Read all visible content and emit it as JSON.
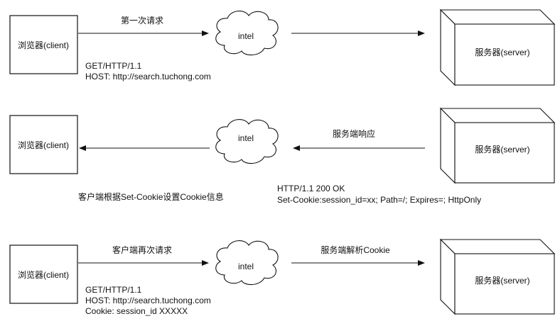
{
  "rows": [
    {
      "client_label": "浏览器(client)",
      "cloud_label": "intel",
      "server_label": "服务器(server)",
      "arrow_left_label": "第一次请求",
      "arrow_right_label": "",
      "note_lines": [
        "GET/HTTP/1.1",
        "HOST: http://search.tuchong.com"
      ]
    },
    {
      "client_label": "浏览器(client)",
      "cloud_label": "intel",
      "server_label": "服务器(server)",
      "arrow_right_label": "服务端响应",
      "note_left": "客户端根据Set-Cookie设置Cookie信息",
      "note_right_lines": [
        "HTTP/1.1 200 OK",
        "Set-Cookie:session_id=xx; Path=/; Expires=; HttpOnly"
      ]
    },
    {
      "client_label": "浏览器(client)",
      "cloud_label": "intel",
      "server_label": "服务器(server)",
      "arrow_left_label": "客户端再次请求",
      "arrow_right_label": "服务端解析Cookie",
      "note_lines": [
        "GET/HTTP/1.1",
        "HOST: http://search.tuchong.com",
        "Cookie: session_id XXXXX"
      ]
    }
  ]
}
